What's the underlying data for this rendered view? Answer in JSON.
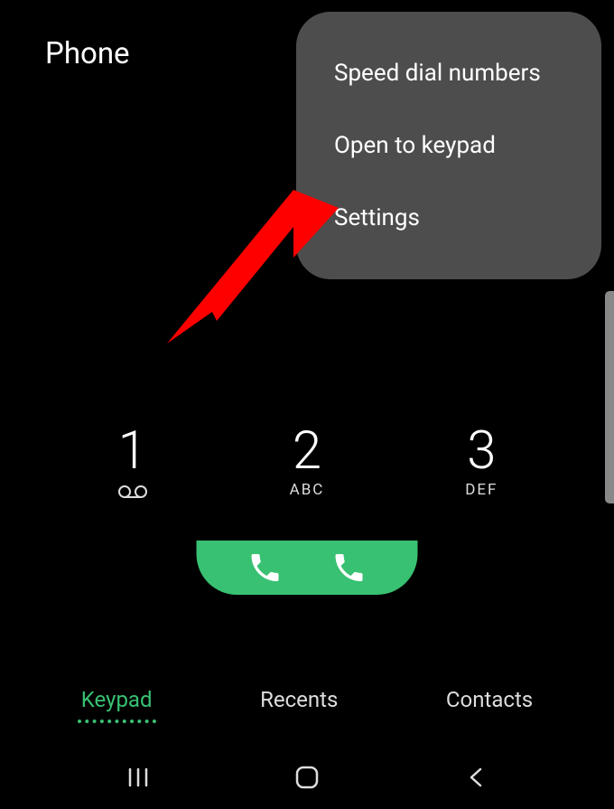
{
  "header": {
    "title": "Phone"
  },
  "menu": {
    "items": [
      {
        "label": "Speed dial numbers"
      },
      {
        "label": "Open to keypad"
      },
      {
        "label": "Settings"
      }
    ]
  },
  "keypad": {
    "keys": [
      {
        "digit": "1",
        "letters": ""
      },
      {
        "digit": "2",
        "letters": "ABC"
      },
      {
        "digit": "3",
        "letters": "DEF"
      }
    ]
  },
  "tabs": {
    "items": [
      {
        "label": "Keypad",
        "active": true
      },
      {
        "label": "Recents",
        "active": false
      },
      {
        "label": "Contacts",
        "active": false
      }
    ]
  },
  "colors": {
    "accent": "#38c172",
    "annotation": "#ff0000"
  }
}
